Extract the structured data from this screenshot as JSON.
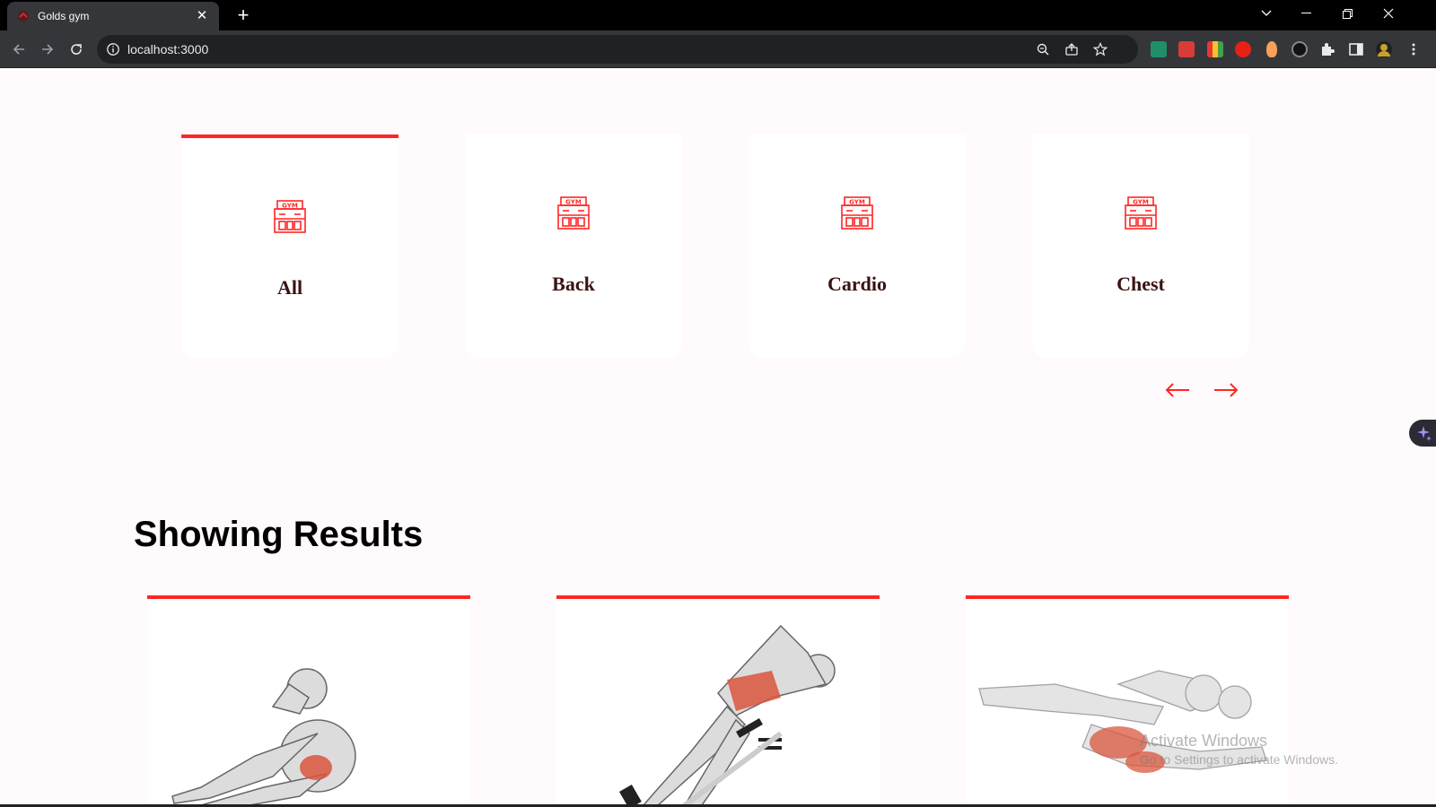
{
  "browser": {
    "tab_title": "Golds gym",
    "url": "localhost:3000",
    "colors": {
      "tabstrip": "#000000",
      "toolbar": "#35363a",
      "omnibox": "#202124"
    }
  },
  "categories": {
    "items": [
      {
        "label": "All",
        "icon": "gym-icon",
        "active": true
      },
      {
        "label": "Back",
        "icon": "gym-icon",
        "active": false
      },
      {
        "label": "Cardio",
        "icon": "gym-icon",
        "active": false
      },
      {
        "label": "Chest",
        "icon": "gym-icon",
        "active": false
      }
    ],
    "prev_icon": "arrow-left-icon",
    "next_icon": "arrow-right-icon"
  },
  "results": {
    "title": "Showing Results",
    "cards": [
      {
        "image": "exercise-crunch-image"
      },
      {
        "image": "exercise-decline-situp-image"
      },
      {
        "image": "exercise-bicycle-crunch-image"
      }
    ]
  },
  "watermark": {
    "line1": "Activate Windows",
    "line2": "Go to Settings to activate Windows."
  },
  "theme": {
    "accent": "#ff2625",
    "label_color": "#3a1212",
    "page_bg": "#fffafb"
  }
}
